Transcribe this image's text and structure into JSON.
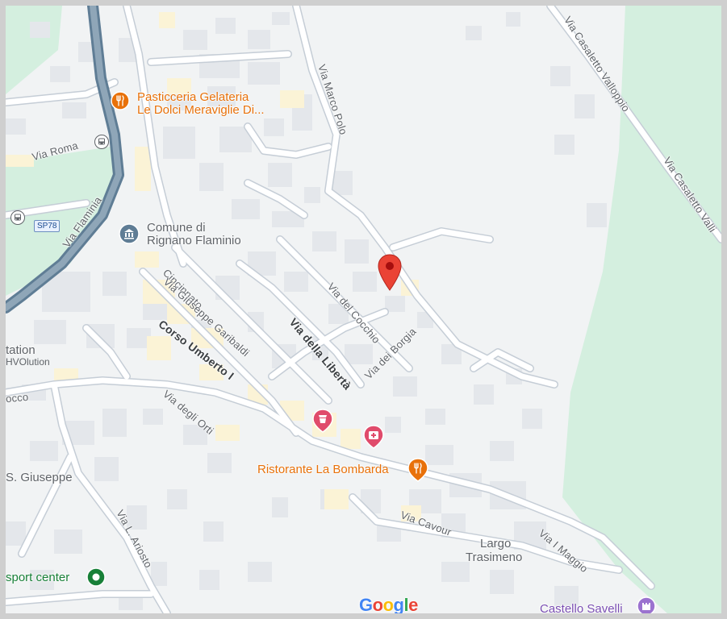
{
  "map": {
    "streets": {
      "via_roma": "Via Roma",
      "via_flaminia": "Via Flaminia",
      "via_marco_polo": "Via Marco Polo",
      "via_casaletto_valloppio": "Via Casaletto Valloppio",
      "via_casaletto_valli": "Via Casaletto Valli",
      "cincinnato": "Cincinnato",
      "via_giuseppe_garibaldi": "Via Giuseppe Garibaldi",
      "corso_umberto": "Corso Umberto I",
      "via_della_liberta": "Via della Libertà",
      "via_del_cocchio": "Via del Cocchio",
      "via_dei_borgia": "Via dei Borgia",
      "via_degli_orti": "Via degli Orti",
      "via_cavour": "Via Cavour",
      "via_i_maggio": "Via I Maggio",
      "via_l_ariosto": "Via L. Ariosto",
      "rocco": "occo"
    },
    "places": {
      "pasticceria_line1": "Pasticceria Gelateria",
      "pasticceria_line2": "Le Dolci Meraviglie Di...",
      "comune_line1": "Comune di",
      "comune_line2": "Rignano Flaminio",
      "ristorante": "Ristorante La Bombarda",
      "largo_line1": "Largo",
      "largo_line2": "Trasimeno",
      "station_line1": "tation",
      "station_line2": "HVOlution",
      "giuseppe": "S. Giuseppe",
      "sport_center": "sport center",
      "castello": "Castello Savelli"
    },
    "route_shield": "SP78",
    "logo": [
      "G",
      "o",
      "o",
      "g",
      "l",
      "e"
    ],
    "icons": {
      "pasticceria": "restaurant-icon",
      "ristorante": "restaurant-icon",
      "comune": "city-hall-icon",
      "bus": "bus-stop-icon",
      "bus2": "bus-stop-icon",
      "pharmacy": "pharmacy-icon",
      "store": "store-icon",
      "sport": "park-icon",
      "castello": "castle-icon",
      "pin": "location-pin-icon"
    },
    "colors": {
      "background": "#f1f3f4",
      "park": "#d4efdf",
      "road": "#ffffff",
      "road_outline": "#c5cdd6",
      "main_road": "#5f7d95",
      "building": "#e4e7eb",
      "highlight_building": "#fbf3d6",
      "pin": "#ea4335",
      "orange_poi": "#e8710a",
      "gray_poi": "#5f6368",
      "pink_poi": "#e04b6b",
      "green_poi": "#188038",
      "purple_poi": "#9b72cf"
    }
  }
}
